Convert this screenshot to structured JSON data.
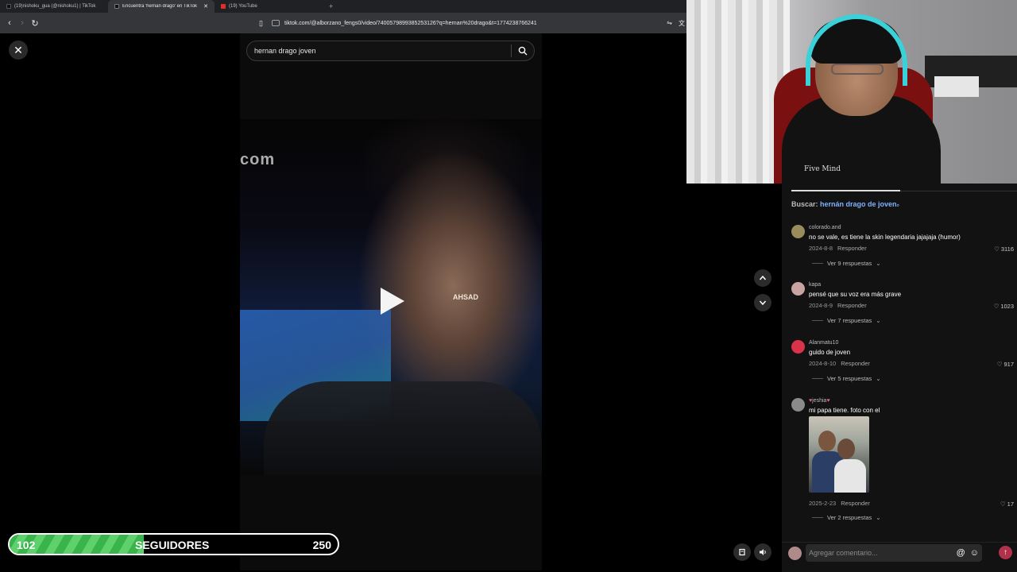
{
  "browser": {
    "tabs": [
      {
        "title": "(19)nishoku_gua (@nishoku1) | TikTok",
        "active": false
      },
      {
        "title": "Encuentra 'hernan drago' en TikTok",
        "active": true
      },
      {
        "title": "(19) YouTube",
        "active": false
      }
    ],
    "url": "tiktok.com/@alborzano_fengs0/video/7400579899385253126?q=hernan%20drago&t=1774238766241"
  },
  "search": {
    "query": "hernan drago joven"
  },
  "video": {
    "watermark_left": "com",
    "watermark_center": "AHSAD"
  },
  "followers": {
    "current": "102",
    "label": "SEGUIDORES",
    "goal": "250",
    "progress_fraction": 0.408
  },
  "webcam": {
    "shirt_text": "Five Mind"
  },
  "comments": {
    "search_prefix": "Buscar:",
    "search_link": "hernán drago de joven",
    "reply_label": "Responder",
    "items": [
      {
        "user": "colorado.and",
        "text": "no se vale, es tiene la skin legendaria jajajaja (humor)",
        "date": "2024-8-8",
        "likes": "3116",
        "more": "Ver 9 respuestas",
        "avatar_color": "#9a8c5c"
      },
      {
        "user": "kapa",
        "text": "pensé que su voz era más grave",
        "date": "2024-8-9",
        "likes": "1023",
        "more": "Ver 7 respuestas",
        "avatar_color": "#c9a2a2"
      },
      {
        "user": "Alanmatu10",
        "text": "guido de joven",
        "date": "2024-8-10",
        "likes": "917",
        "more": "Ver 5 respuestas",
        "avatar_color": "#d8334a"
      },
      {
        "user": "jeshia",
        "text": "mi papa tiene. foto con el",
        "date": "2025-2-23",
        "likes": "17",
        "more": "Ver 2 respuestas",
        "avatar_color": "#8a8a8a"
      }
    ],
    "composer_placeholder": "Agregar comentario..."
  },
  "icons": [
    "close-icon",
    "search-icon",
    "play-icon",
    "chevron-up-icon",
    "chevron-down-icon",
    "heart-icon",
    "volume-icon",
    "mention-icon",
    "emoji-icon",
    "send-icon"
  ]
}
